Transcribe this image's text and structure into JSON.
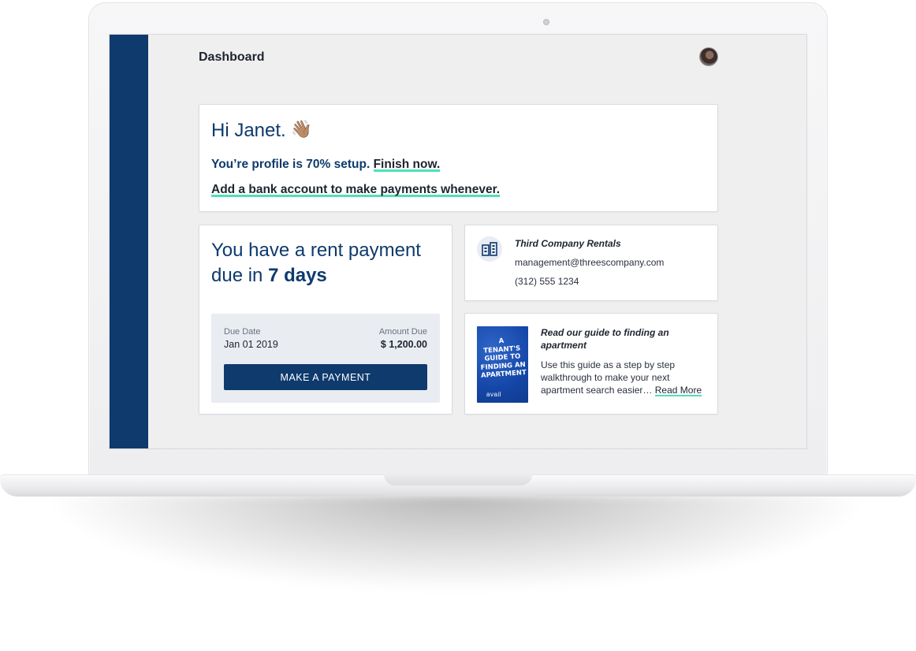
{
  "header": {
    "title": "Dashboard"
  },
  "welcome": {
    "greeting": "Hi Janet.",
    "wave_emoji": "👋🏽",
    "setup_text": "You’re profile is 70% setup.",
    "finish_link": "Finish now.",
    "bank_link": "Add a bank account to make payments whenever."
  },
  "rent": {
    "headline_prefix": "You have a rent payment due in",
    "headline_emphasis": "7 days",
    "due_date_label": "Due Date",
    "due_date_value": "Jan 01 2019",
    "amount_label": "Amount Due",
    "amount_value": "$ 1,200.00",
    "pay_button": "MAKE A PAYMENT"
  },
  "landlord": {
    "name": "Third Company Rentals",
    "email": "management@threescompany.com",
    "phone": "(312) 555 1234"
  },
  "guide": {
    "cover_lines": [
      "A",
      "TENANT'S",
      "GUIDE TO",
      "FINDING AN",
      "APARTMENT"
    ],
    "cover_logo": "avail",
    "title": "Read our guide to finding an apartment",
    "body": "Use this guide as a step by step walkthrough to make your next apartment search easier…",
    "read_more": "Read More"
  },
  "colors": {
    "navy": "#0e3a6d",
    "highlight": "#4ee0b7",
    "panel": "#e9ecf1"
  },
  "icons": [
    "building-icon",
    "wave-icon",
    "avatar"
  ]
}
